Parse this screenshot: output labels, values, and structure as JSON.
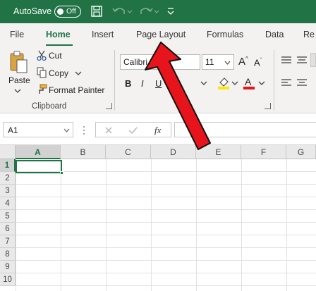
{
  "titlebar": {
    "autosave_label": "AutoSave",
    "toggle_state": "Off",
    "accent_color": "#217346"
  },
  "tabs": [
    {
      "label": "File",
      "active": false
    },
    {
      "label": "Home",
      "active": true
    },
    {
      "label": "Insert",
      "active": false
    },
    {
      "label": "Page Layout",
      "active": false
    },
    {
      "label": "Formulas",
      "active": false
    },
    {
      "label": "Data",
      "active": false
    },
    {
      "label": "Re",
      "active": false
    }
  ],
  "ribbon": {
    "clipboard": {
      "paste": "Paste",
      "cut": "Cut",
      "copy": "Copy",
      "format_painter": "Format Painter",
      "group_label": "Clipboard"
    },
    "font": {
      "font_name": "Calibri",
      "font_size": "11",
      "bold": "B",
      "italic": "I",
      "underline": "U",
      "group_label_partial": "nt"
    }
  },
  "formula_bar": {
    "name_box": "A1",
    "fx": "fx",
    "formula": ""
  },
  "grid": {
    "columns": [
      "A",
      "B",
      "C",
      "D",
      "E",
      "F",
      "G"
    ],
    "rows": [
      "1",
      "2",
      "3",
      "4",
      "5",
      "6",
      "7",
      "8",
      "9",
      "10"
    ],
    "selected_cell": "A1"
  },
  "annotation": {
    "arrow_color": "#e8141b",
    "target": "Page Layout"
  }
}
